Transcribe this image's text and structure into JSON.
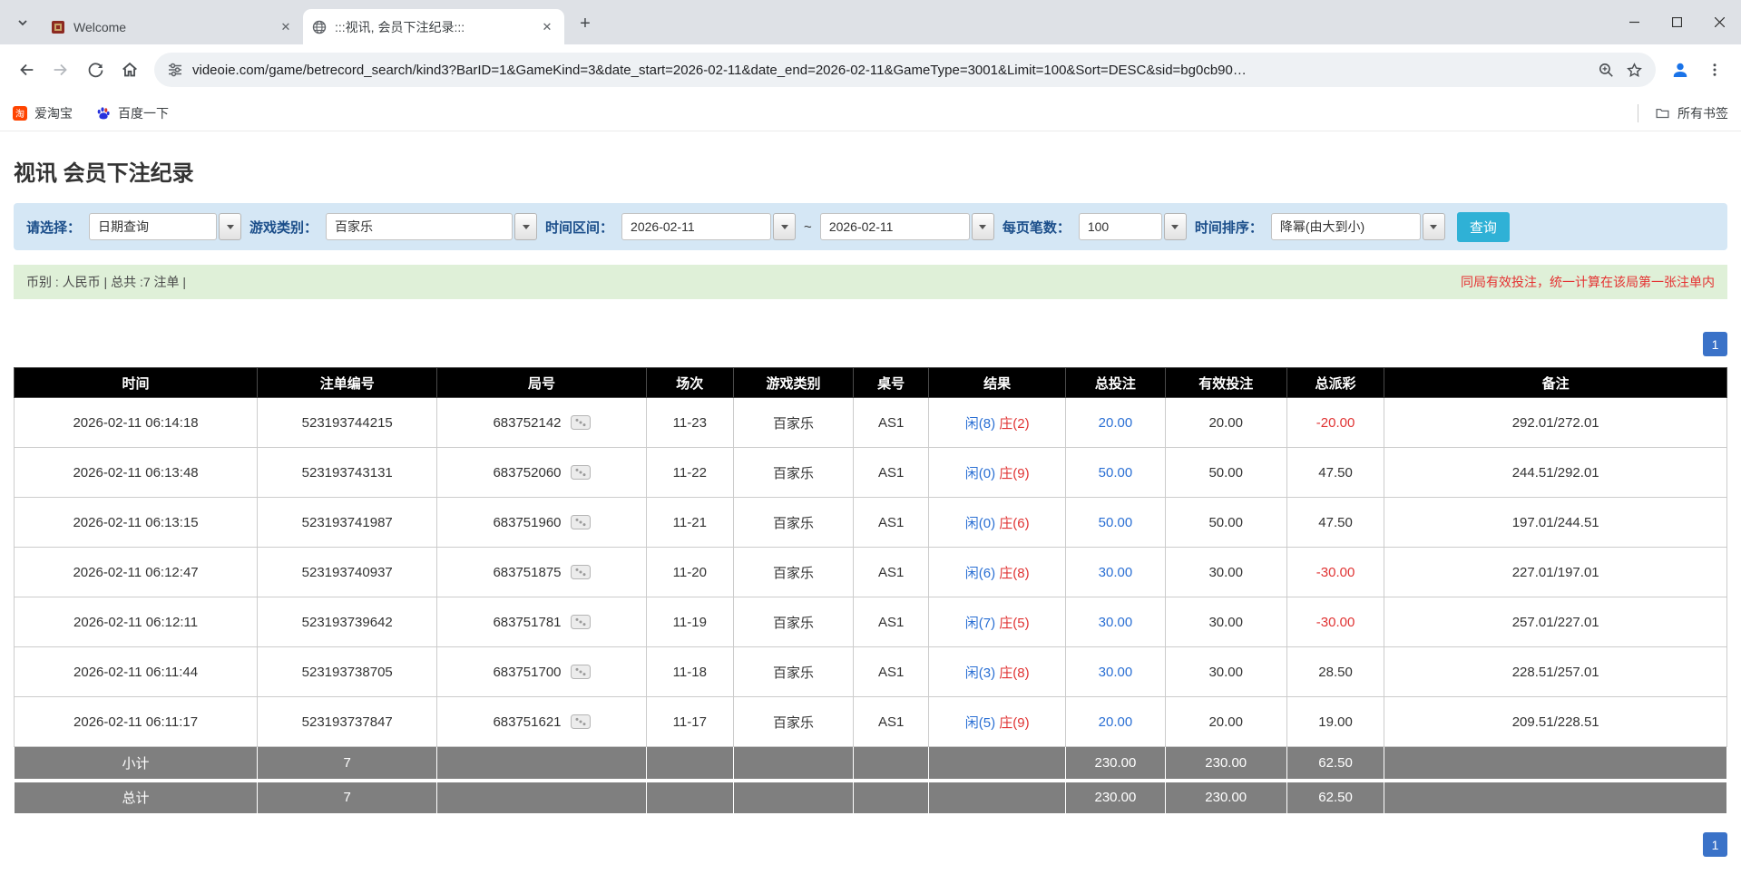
{
  "browser": {
    "tabs": [
      {
        "title": "Welcome",
        "active": false
      },
      {
        "title": ":::视讯, 会员下注纪录:::",
        "active": true
      }
    ],
    "url": "videoie.com/game/betrecord_search/kind3?BarID=1&GameKind=3&date_start=2026-02-11&date_end=2026-02-11&GameType=3001&Limit=100&Sort=DESC&sid=bg0cb90…",
    "bookmarks": [
      {
        "label": "爱淘宝"
      },
      {
        "label": "百度一下"
      }
    ],
    "all_bookmarks_label": "所有书签"
  },
  "page": {
    "title": "视讯 会员下注纪录",
    "filter": {
      "select_label": "请选择：",
      "select_value": "日期查询",
      "game_label": "游戏类别：",
      "game_value": "百家乐",
      "range_label": "时间区间：",
      "date_start": "2026-02-11",
      "range_separator": "~",
      "date_end": "2026-02-11",
      "page_size_label": "每页笔数：",
      "page_size_value": "100",
      "sort_label": "时间排序：",
      "sort_value": "降幂(由大到小)",
      "search_button": "查询"
    },
    "summary_bar": {
      "left": "币别 : 人民币 | 总共 :7 注单 |",
      "right": "同局有效投注，统一计算在该局第一张注单内"
    },
    "pagination": {
      "page": "1"
    },
    "table": {
      "headers": [
        "时间",
        "注单编号",
        "局号",
        "场次",
        "游戏类别",
        "桌号",
        "结果",
        "总投注",
        "有效投注",
        "总派彩",
        "备注"
      ],
      "rows": [
        {
          "time": "2026-02-11 06:14:18",
          "bet_id": "523193744215",
          "round": "683752142",
          "session": "11-23",
          "game": "百家乐",
          "table": "AS1",
          "result": {
            "player": "闲(8)",
            "banker": "庄(2)"
          },
          "total_bet": "20.00",
          "valid_bet": "20.00",
          "payout": "-20.00",
          "note": "292.01/272.01"
        },
        {
          "time": "2026-02-11 06:13:48",
          "bet_id": "523193743131",
          "round": "683752060",
          "session": "11-22",
          "game": "百家乐",
          "table": "AS1",
          "result": {
            "player": "闲(0)",
            "banker": "庄(9)"
          },
          "total_bet": "50.00",
          "valid_bet": "50.00",
          "payout": "47.50",
          "note": "244.51/292.01"
        },
        {
          "time": "2026-02-11 06:13:15",
          "bet_id": "523193741987",
          "round": "683751960",
          "session": "11-21",
          "game": "百家乐",
          "table": "AS1",
          "result": {
            "player": "闲(0)",
            "banker": "庄(6)"
          },
          "total_bet": "50.00",
          "valid_bet": "50.00",
          "payout": "47.50",
          "note": "197.01/244.51"
        },
        {
          "time": "2026-02-11 06:12:47",
          "bet_id": "523193740937",
          "round": "683751875",
          "session": "11-20",
          "game": "百家乐",
          "table": "AS1",
          "result": {
            "player": "闲(6)",
            "banker": "庄(8)"
          },
          "total_bet": "30.00",
          "valid_bet": "30.00",
          "payout": "-30.00",
          "note": "227.01/197.01"
        },
        {
          "time": "2026-02-11 06:12:11",
          "bet_id": "523193739642",
          "round": "683751781",
          "session": "11-19",
          "game": "百家乐",
          "table": "AS1",
          "result": {
            "player": "闲(7)",
            "banker": "庄(5)"
          },
          "total_bet": "30.00",
          "valid_bet": "30.00",
          "payout": "-30.00",
          "note": "257.01/227.01"
        },
        {
          "time": "2026-02-11 06:11:44",
          "bet_id": "523193738705",
          "round": "683751700",
          "session": "11-18",
          "game": "百家乐",
          "table": "AS1",
          "result": {
            "player": "闲(3)",
            "banker": "庄(8)"
          },
          "total_bet": "30.00",
          "valid_bet": "30.00",
          "payout": "28.50",
          "note": "228.51/257.01"
        },
        {
          "time": "2026-02-11 06:11:17",
          "bet_id": "523193737847",
          "round": "683751621",
          "session": "11-17",
          "game": "百家乐",
          "table": "AS1",
          "result": {
            "player": "闲(5)",
            "banker": "庄(9)"
          },
          "total_bet": "20.00",
          "valid_bet": "20.00",
          "payout": "19.00",
          "note": "209.51/228.51"
        }
      ],
      "subtotal": {
        "label": "小计",
        "count": "7",
        "total_bet": "230.00",
        "valid_bet": "230.00",
        "payout": "62.50"
      },
      "grand_total": {
        "label": "总计",
        "count": "7",
        "total_bet": "230.00",
        "valid_bet": "230.00",
        "payout": "62.50"
      }
    },
    "colors": {
      "accent_blue": "#2a6fd4",
      "negative_red": "#e03333",
      "player_blue": "#2a6fd4",
      "banker_red": "#e03333",
      "header_bg": "#000000",
      "footer_bg": "#7f7f7f",
      "filter_bar_bg": "#d5e7f5",
      "summary_bar_bg": "#dff0d8",
      "search_button_bg": "#2fb1d6",
      "pagination_bg": "#3a72c8"
    }
  }
}
